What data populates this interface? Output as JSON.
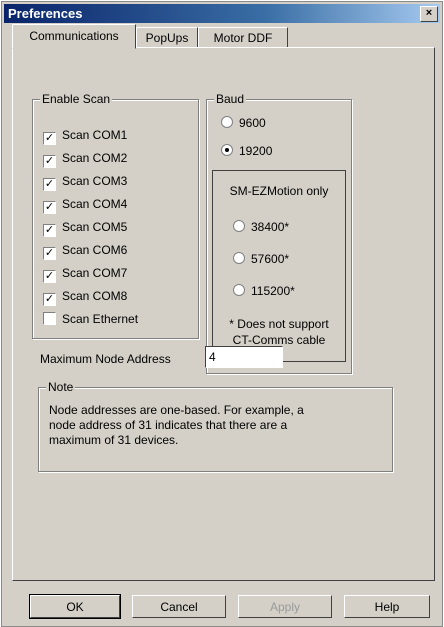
{
  "window": {
    "title": "Preferences",
    "close_label": "×"
  },
  "tabs": [
    {
      "label": "Communications",
      "active": true
    },
    {
      "label": "PopUps",
      "active": false
    },
    {
      "label": "Motor DDF",
      "active": false
    }
  ],
  "enable_scan": {
    "legend": "Enable Scan",
    "items": [
      {
        "label": "Scan COM1",
        "checked": true
      },
      {
        "label": "Scan COM2",
        "checked": true
      },
      {
        "label": "Scan COM3",
        "checked": true
      },
      {
        "label": "Scan COM4",
        "checked": true
      },
      {
        "label": "Scan COM5",
        "checked": true
      },
      {
        "label": "Scan COM6",
        "checked": true
      },
      {
        "label": "Scan COM7",
        "checked": true
      },
      {
        "label": "Scan COM8",
        "checked": true
      },
      {
        "label": "Scan Ethernet",
        "checked": false
      }
    ],
    "check_mark": "✓"
  },
  "baud": {
    "legend": "Baud",
    "options": [
      {
        "label": "9600",
        "selected": false
      },
      {
        "label": "19200",
        "selected": true
      }
    ],
    "sm_ezmotion": {
      "title": "SM-EZMotion only",
      "options": [
        {
          "label": "38400*",
          "selected": false
        },
        {
          "label": "57600*",
          "selected": false
        },
        {
          "label": "115200*",
          "selected": false
        }
      ],
      "footnote_line1": "* Does not support",
      "footnote_line2": "CT-Comms cable"
    }
  },
  "max_node": {
    "label": "Maximum Node Address",
    "value": "4"
  },
  "note": {
    "legend": "Note",
    "line1": "Node addresses are one-based.  For example, a",
    "line2": "node address of 31 indicates that there are a",
    "line3": "maximum of 31 devices."
  },
  "buttons": {
    "ok": "OK",
    "cancel": "Cancel",
    "apply": "Apply",
    "help": "Help"
  }
}
